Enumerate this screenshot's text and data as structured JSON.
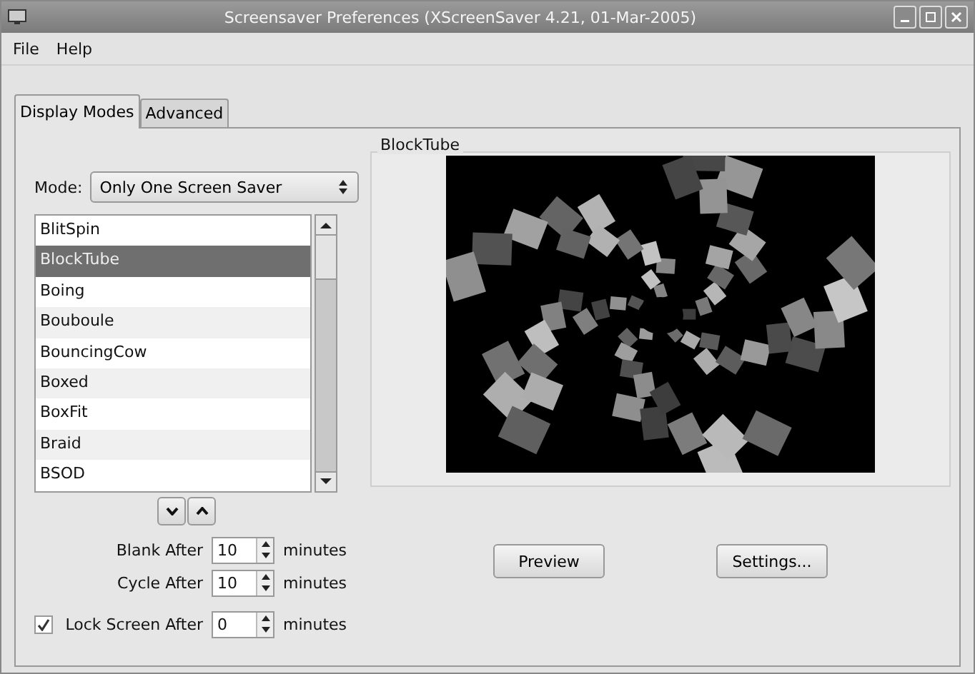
{
  "window": {
    "title": "Screensaver Preferences  (XScreenSaver 4.21, 01-Mar-2005)"
  },
  "menu": [
    "File",
    "Help"
  ],
  "tabs": [
    {
      "label": "Display Modes",
      "selected": true
    },
    {
      "label": "Advanced",
      "selected": false
    }
  ],
  "mode": {
    "label": "Mode:",
    "value": "Only One Screen Saver"
  },
  "savers": [
    {
      "name": "BlitSpin",
      "selected": false
    },
    {
      "name": "BlockTube",
      "selected": true
    },
    {
      "name": "Boing",
      "selected": false
    },
    {
      "name": "Bouboule",
      "selected": false
    },
    {
      "name": "BouncingCow",
      "selected": false
    },
    {
      "name": "Boxed",
      "selected": false
    },
    {
      "name": "BoxFit",
      "selected": false
    },
    {
      "name": "Braid",
      "selected": false
    },
    {
      "name": "BSOD",
      "selected": false
    }
  ],
  "timers": [
    {
      "label": "Blank After",
      "value": "10",
      "unit": "minutes",
      "kind": "plain"
    },
    {
      "label": "Cycle After",
      "value": "10",
      "unit": "minutes",
      "kind": "plain"
    },
    {
      "label": "Lock Screen After",
      "value": "0",
      "unit": "minutes",
      "kind": "checkbox",
      "checked": true
    }
  ],
  "preview": {
    "title": "BlockTube"
  },
  "buttons": [
    "Preview",
    "Settings..."
  ]
}
